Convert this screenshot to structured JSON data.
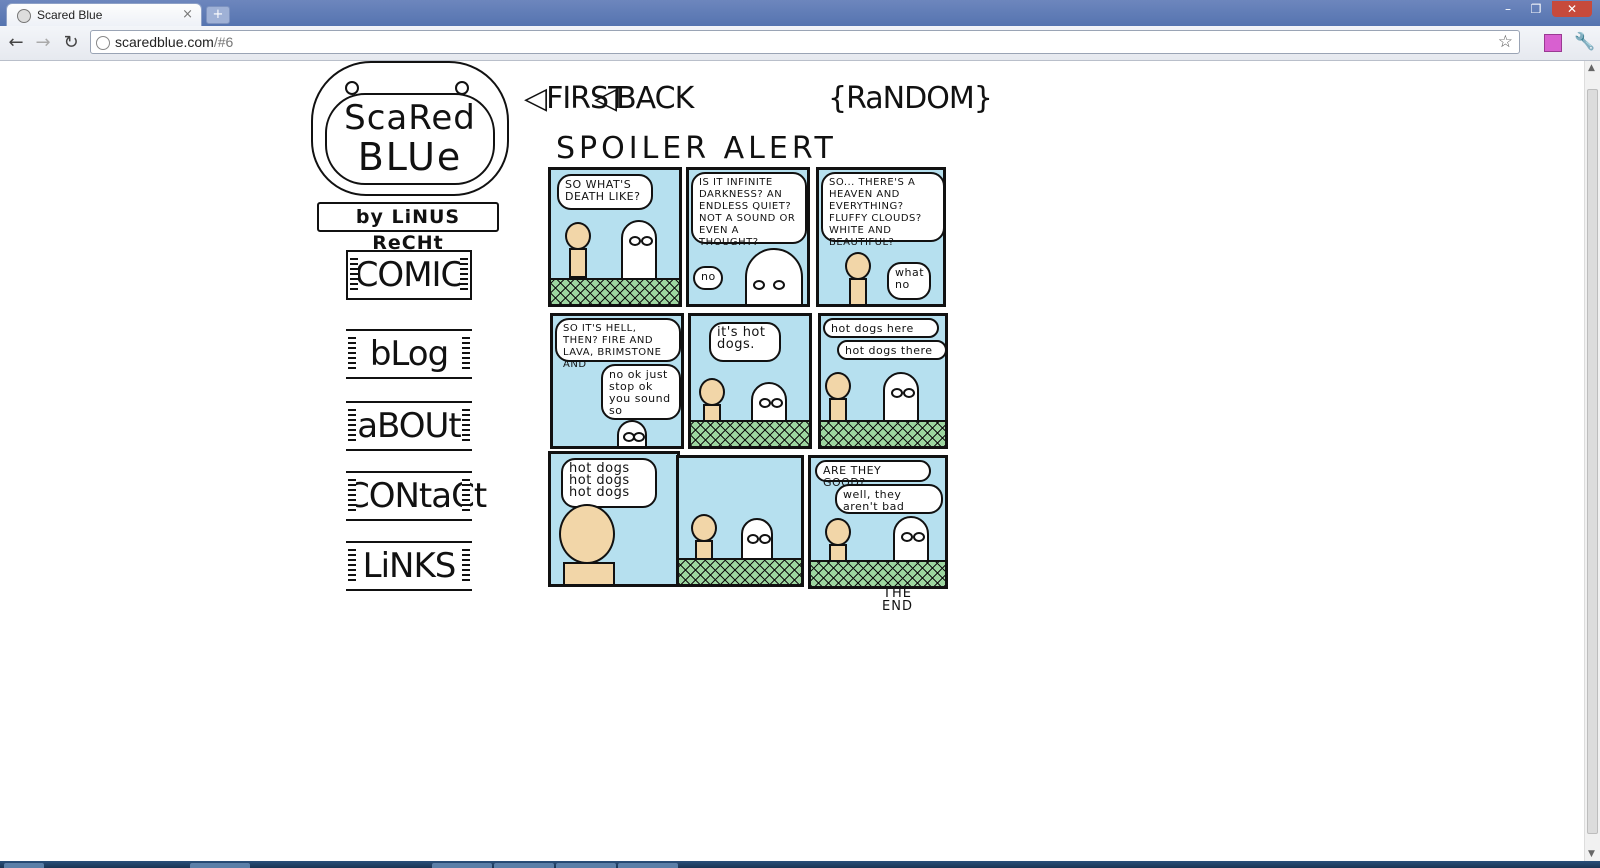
{
  "browser": {
    "tab_title": "Scared Blue",
    "tab_close": "×",
    "new_tab": "+",
    "url_host": "scaredblue.com",
    "url_path": "/#6",
    "back": "←",
    "forward": "→",
    "reload": "↻",
    "star": "☆",
    "wrench": "🔧",
    "window_min": "–",
    "window_max": "❐",
    "window_close": "✕"
  },
  "site": {
    "logo_line1": "ScaRed",
    "logo_line2": "BLUe",
    "byline": "by LiNUS ReCHt",
    "menu": [
      {
        "label": "COMIC"
      },
      {
        "label": "bLog"
      },
      {
        "label": "aBOUt"
      },
      {
        "label": "CONtaCt"
      },
      {
        "label": "LiNKS"
      }
    ],
    "nav_first": "FIRST",
    "nav_back": "BACK",
    "nav_random": "RaNDOM"
  },
  "comic": {
    "title": "SPOILER ALERT",
    "panels": [
      {
        "text": "SO WHAT'S DEATH LIKE?"
      },
      {
        "text": "IS IT INFINITE DARKNESS? AN ENDLESS QUIET? NOT A SOUND OR EVEN A THOUGHT?",
        "reply": "no"
      },
      {
        "text": "SO... THERE'S A HEAVEN AND EVERYTHING? FLUFFY CLOUDS? WHITE AND BEAUTIFUL?",
        "reply": "what no"
      },
      {
        "text": "SO IT'S HELL, THEN? FIRE AND LAVA, BRIMSTONE AND",
        "reply": "no ok just stop ok you sound so"
      },
      {
        "text": "it's hot dogs."
      },
      {
        "text": "hot dogs here",
        "reply": "hot dogs there"
      },
      {
        "text": "hot dogs hot dogs hot dogs"
      },
      {
        "text": ""
      },
      {
        "text": "ARE THEY GOOD?",
        "reply": "well, they aren't bad"
      }
    ],
    "end_line1": "THE",
    "end_line2": "END"
  }
}
